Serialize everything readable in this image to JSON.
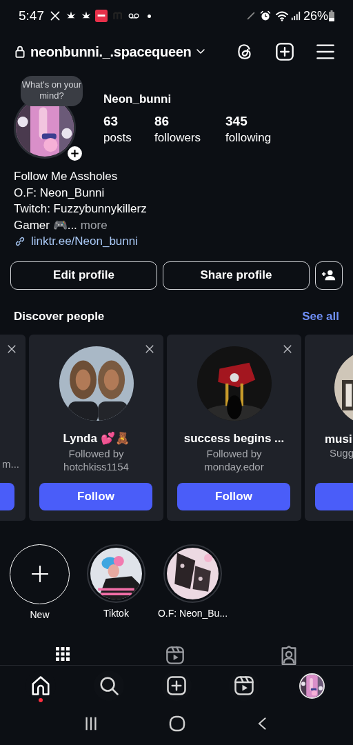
{
  "status_bar": {
    "time": "5:47",
    "battery": "26%"
  },
  "header": {
    "username": "neonbunni._.spacequeen"
  },
  "profile": {
    "note": "What's on your mind?",
    "name": "Neon_bunni",
    "stats": [
      {
        "value": "63",
        "label": "posts"
      },
      {
        "value": "86",
        "label": "followers"
      },
      {
        "value": "345",
        "label": "following"
      }
    ],
    "bio": [
      "Follow Me Assholes",
      "O.F: Neon_Bunni",
      "Twitch: Fuzzybunnykillerz"
    ],
    "bio_last": "Gamer 🎮...",
    "more": "more",
    "link": "linktr.ee/Neon_bunni"
  },
  "actions": [
    "Edit profile",
    "Share profile"
  ],
  "discover": {
    "title": "Discover people",
    "see_all": "See all",
    "cards": [
      {
        "kind": "partial_left",
        "lines": [
          "m..."
        ],
        "dismissable": true
      },
      {
        "kind": "full",
        "name": "Lynda 💕🧸",
        "lines": [
          "Followed by",
          "hotchkiss1154"
        ],
        "button": "Follow",
        "dismissable": true
      },
      {
        "kind": "full",
        "name": "success begins ...",
        "lines": [
          "Followed by",
          "monday.edor"
        ],
        "button": "Follow",
        "dismissable": true
      },
      {
        "kind": "partial_right",
        "name": "musi",
        "lines": [
          "Sugg"
        ]
      }
    ]
  },
  "highlights": [
    {
      "kind": "new",
      "label": "New"
    },
    {
      "kind": "picture",
      "label": "Tiktok"
    },
    {
      "kind": "picture",
      "label": "O.F: Neon_Bu..."
    }
  ],
  "profile_tabs": [
    {
      "kind": "grid",
      "selected": true
    },
    {
      "kind": "reels",
      "selected": false
    },
    {
      "kind": "tagged",
      "selected": false
    }
  ],
  "bottom_nav": [
    {
      "kind": "home",
      "selected": true,
      "notification": true
    },
    {
      "kind": "search",
      "selected": false,
      "notification": false
    },
    {
      "kind": "create",
      "selected": false,
      "notification": false
    },
    {
      "kind": "reels",
      "selected": false,
      "notification": false
    },
    {
      "kind": "profile",
      "selected": false,
      "notification": false
    }
  ]
}
